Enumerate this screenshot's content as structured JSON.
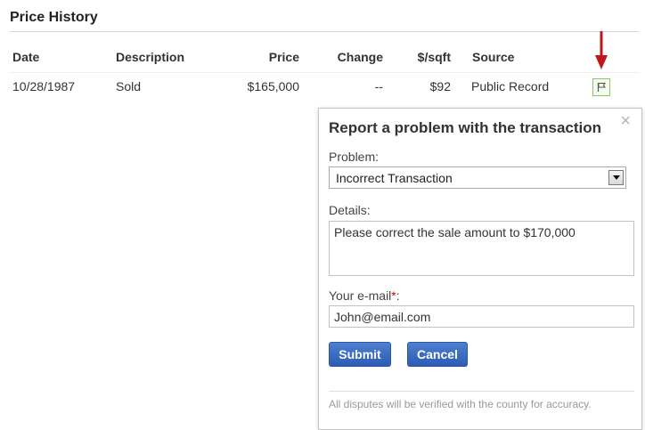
{
  "section": {
    "title": "Price History"
  },
  "table": {
    "columns": [
      "Date",
      "Description",
      "Price",
      "Change",
      "$/sqft",
      "Source"
    ],
    "rows": [
      {
        "date": "10/28/1987",
        "description": "Sold",
        "price": "$165,000",
        "change": "--",
        "price_per_sqft": "$92",
        "source": "Public Record",
        "action_icon": "flag-icon"
      }
    ]
  },
  "annotation": {
    "icon": "red-arrow-down-icon",
    "color": "#c0161c"
  },
  "report_dialog": {
    "title": "Report a problem with the transaction",
    "close_glyph": "×",
    "problem_label": "Problem:",
    "problem_selected": "Incorrect Transaction",
    "details_label": "Details:",
    "details_value": "Please correct the sale amount to $170,000",
    "email_label": "Your e-mail",
    "email_required_marker": "*",
    "email_label_suffix": ":",
    "email_value": "John@email.com",
    "submit_label": "Submit",
    "cancel_label": "Cancel",
    "footer_note": "All disputes will be verified with the county for accuracy."
  },
  "colors": {
    "button_blue": "#2c5cb4",
    "flag_green": "#8cc56a",
    "required_red": "#cc0000"
  }
}
